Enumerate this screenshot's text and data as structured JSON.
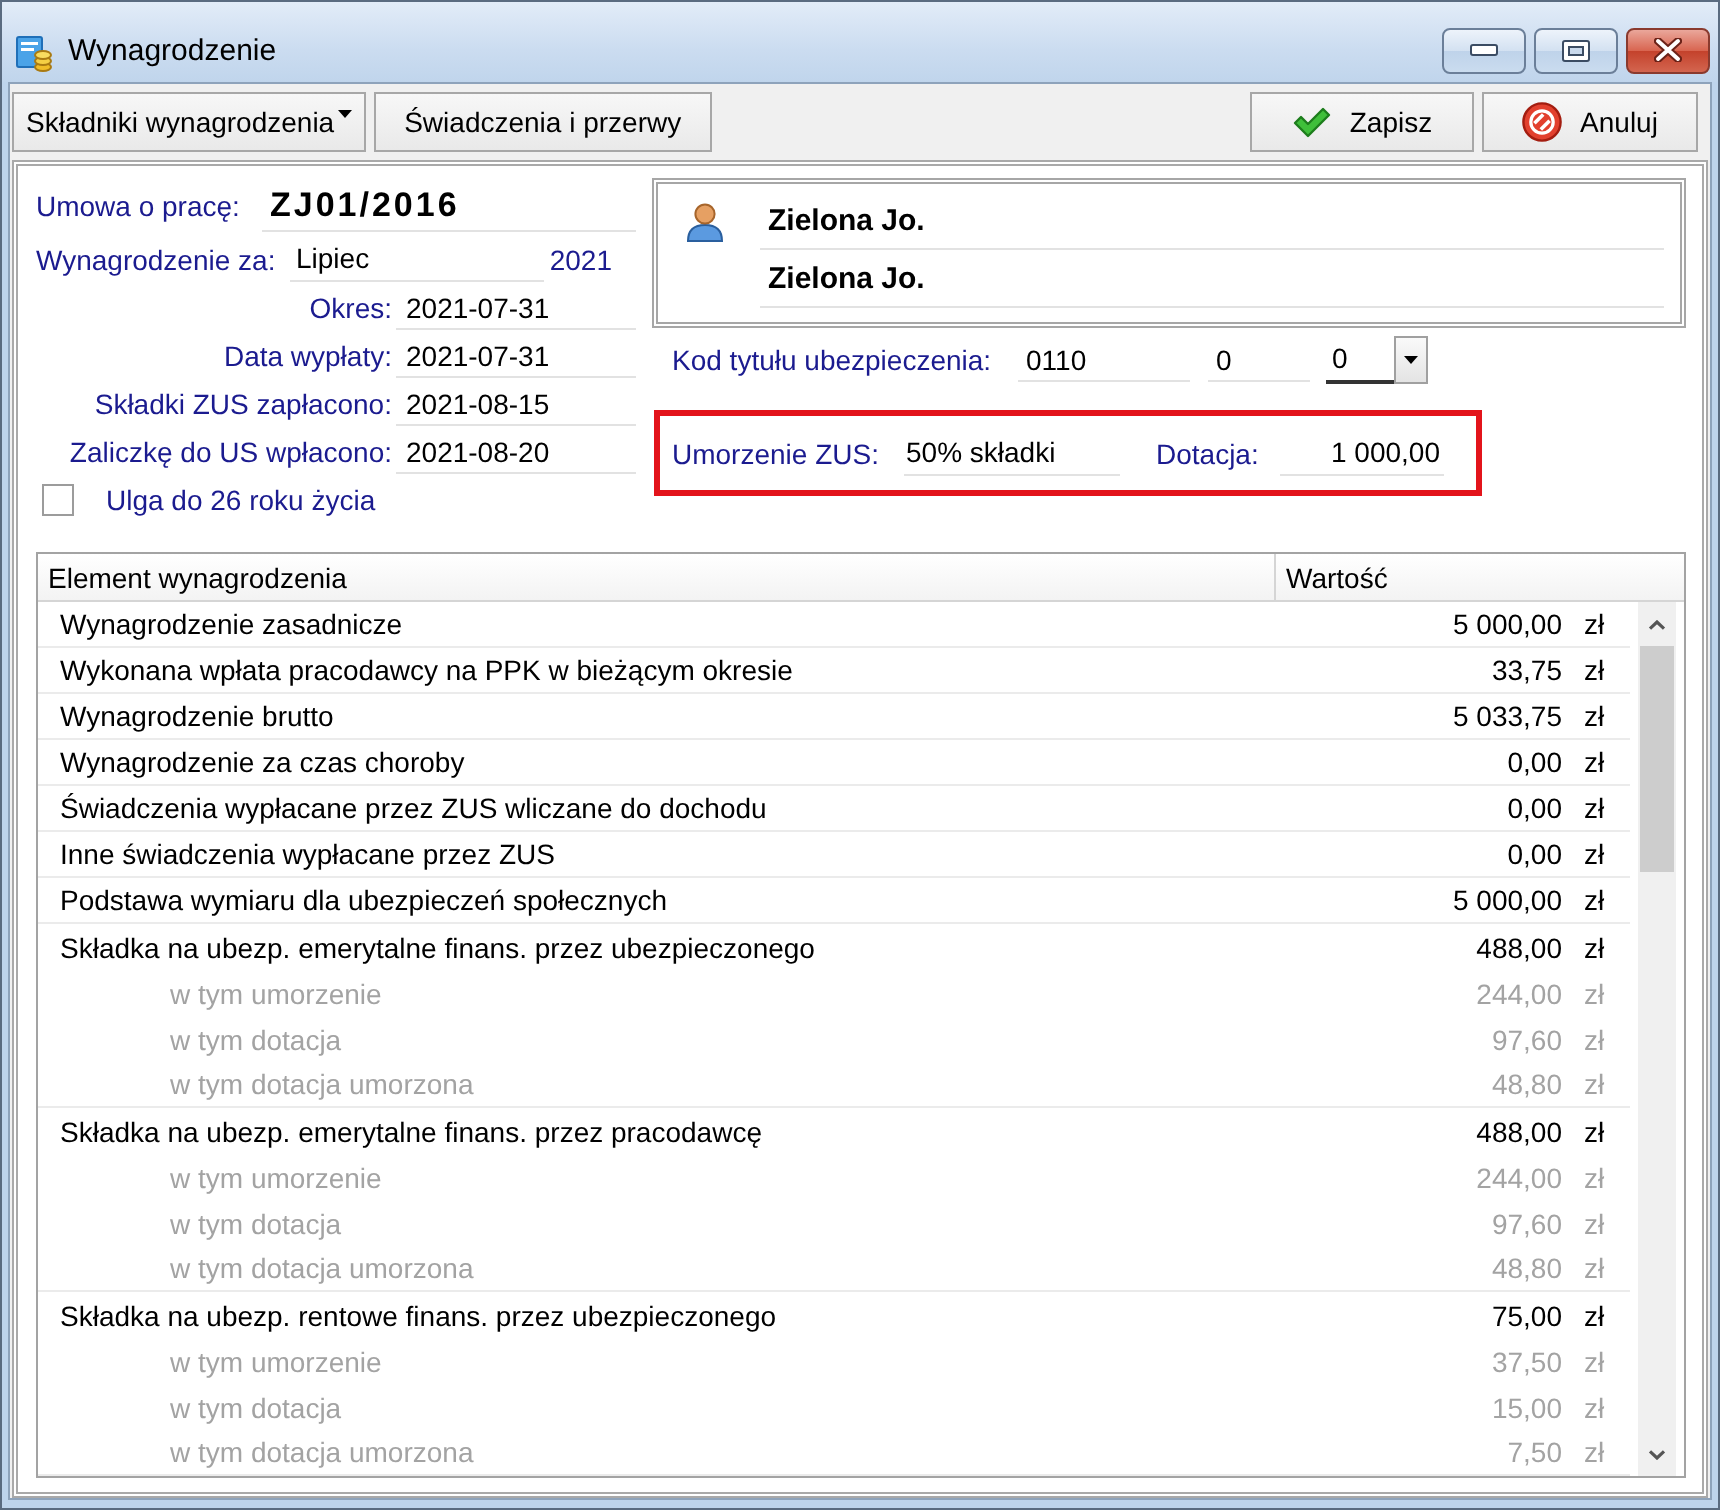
{
  "window": {
    "title": "Wynagrodzenie"
  },
  "toolbar": {
    "left_buttons": [
      {
        "label": "Składniki wynagrodzenia",
        "kind": "menu"
      },
      {
        "label": "Świadczenia i przerwy",
        "kind": "plain"
      }
    ],
    "right_buttons": [
      {
        "label": "Zapisz",
        "kind": "save"
      },
      {
        "label": "Anuluj",
        "kind": "cancel"
      }
    ]
  },
  "contract": {
    "label": "Umowa o pracę:",
    "value": "ZJ01/2016"
  },
  "salary_for": {
    "label": "Wynagrodzenie za:",
    "month": "Lipiec",
    "year": "2021"
  },
  "dates": [
    {
      "label": "Okres:",
      "value": "2021-07-31"
    },
    {
      "label": "Data wypłaty:",
      "value": "2021-07-31"
    },
    {
      "label": "Składki ZUS zapłacono:",
      "value": "2021-08-15"
    },
    {
      "label": "Zaliczkę do US wpłacono:",
      "value": "2021-08-20"
    }
  ],
  "relief_under_26": {
    "label": "Ulga do 26 roku życia",
    "checked": false
  },
  "employee": {
    "name_lines": [
      "Zielona Jo.",
      "Zielona Jo."
    ]
  },
  "insurance": {
    "label": "Kod tytułu ubezpieczenia:",
    "code": "0110",
    "field_2": "0",
    "dropdown_value": "0"
  },
  "zus_relief": {
    "highlighted": true,
    "relief_label": "Umorzenie ZUS:",
    "relief_value": "50% składki",
    "subsidy_label": "Dotacja:",
    "subsidy_value": "1 000,00"
  },
  "table": {
    "columns": [
      "Element wynagrodzenia",
      "Wartość"
    ],
    "rows": [
      {
        "name": "Wynagrodzenie zasadnicze",
        "value": "5 000,00",
        "currency": "zł"
      },
      {
        "name": "Wykonana wpłata pracodawcy na PPK w bieżącym okresie",
        "value": "33,75",
        "currency": "zł"
      },
      {
        "name": "Wynagrodzenie brutto",
        "value": "5 033,75",
        "currency": "zł"
      },
      {
        "name": "Wynagrodzenie za czas choroby",
        "value": "0,00",
        "currency": "zł"
      },
      {
        "name": "Świadczenia wypłacane przez ZUS wliczane do dochodu",
        "value": "0,00",
        "currency": "zł"
      },
      {
        "name": "Inne świadczenia wypłacane przez ZUS",
        "value": "0,00",
        "currency": "zł"
      },
      {
        "name": "Podstawa wymiaru dla ubezpieczeń społecznych",
        "value": "5 000,00",
        "currency": "zł"
      },
      {
        "name": "Składka na ubezp. emerytalne finans. przez ubezpieczonego",
        "value": "488,00",
        "currency": "zł",
        "children": [
          {
            "name": "w tym umorzenie",
            "value": "244,00",
            "currency": "zł"
          },
          {
            "name": "w tym dotacja",
            "value": "97,60",
            "currency": "zł"
          },
          {
            "name": "w tym dotacja umorzona",
            "value": "48,80",
            "currency": "zł"
          }
        ]
      },
      {
        "name": "Składka na ubezp. emerytalne finans. przez pracodawcę",
        "value": "488,00",
        "currency": "zł",
        "children": [
          {
            "name": "w tym umorzenie",
            "value": "244,00",
            "currency": "zł"
          },
          {
            "name": "w tym dotacja",
            "value": "97,60",
            "currency": "zł"
          },
          {
            "name": "w tym dotacja umorzona",
            "value": "48,80",
            "currency": "zł"
          }
        ]
      },
      {
        "name": "Składka na ubezp. rentowe finans. przez ubezpieczonego",
        "value": "75,00",
        "currency": "zł",
        "children": [
          {
            "name": "w tym umorzenie",
            "value": "37,50",
            "currency": "zł"
          },
          {
            "name": "w tym dotacja",
            "value": "15,00",
            "currency": "zł"
          },
          {
            "name": "w tym dotacja umorzona",
            "value": "7,50",
            "currency": "zł"
          }
        ]
      }
    ]
  }
}
